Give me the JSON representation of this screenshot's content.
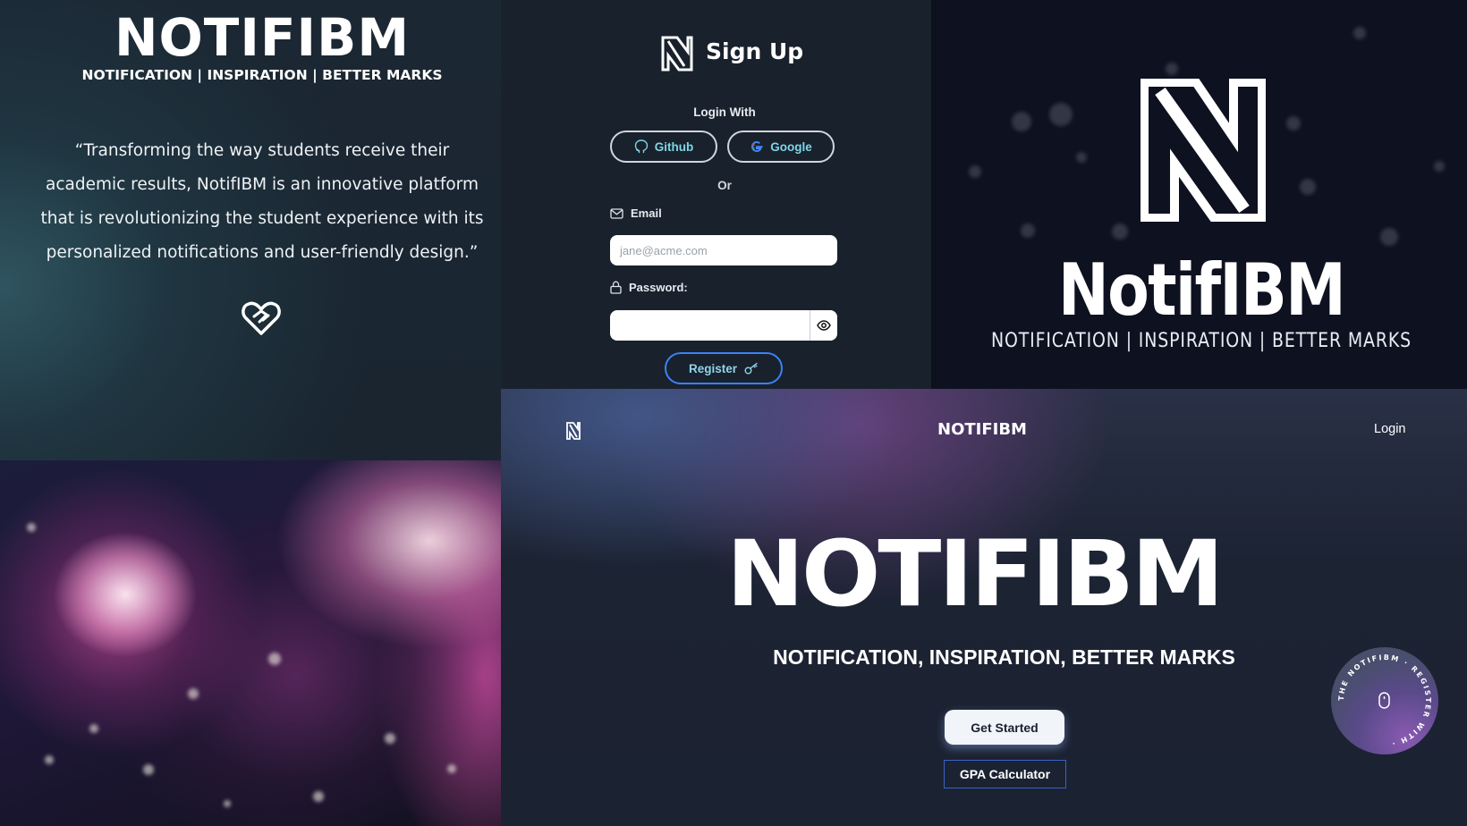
{
  "hero": {
    "title": "NOTIFIBM",
    "subtitle": "NOTIFICATION | INSPIRATION | BETTER MARKS",
    "quote": "“Transforming the way students receive their academic results, NotifIBM is an innovative platform that is revolutionizing the student experience with its personalized notifications and user-friendly design.”",
    "icon": "heart-handshake-icon"
  },
  "signup": {
    "title": "Sign Up",
    "login_with": "Login With",
    "github_label": "Github",
    "google_label": "Google",
    "or_label": "Or",
    "email_label": "Email",
    "email_placeholder": "jane@acme.com",
    "email_value": "",
    "password_label": "Password:",
    "password_value": "",
    "register_label": "Register"
  },
  "brand": {
    "name": "NotifIBM",
    "subtitle": "NOTIFICATION | INSPIRATION | BETTER MARKS"
  },
  "landing": {
    "nav_brand": "NOTIFIBM",
    "login_label": "Login",
    "title": "NOTIFIBM",
    "subtitle": "NOTIFICATION, INSPIRATION, BETTER MARKS",
    "get_started_label": "Get Started",
    "gpa_label": "GPA Calculator",
    "badge_text": "THE NOTIFIBM · REGISTER WITH ·"
  },
  "colors": {
    "accent_cyan": "#7fd6e8",
    "accent_blue": "#3b82f6",
    "background_dark": "#19212c"
  }
}
